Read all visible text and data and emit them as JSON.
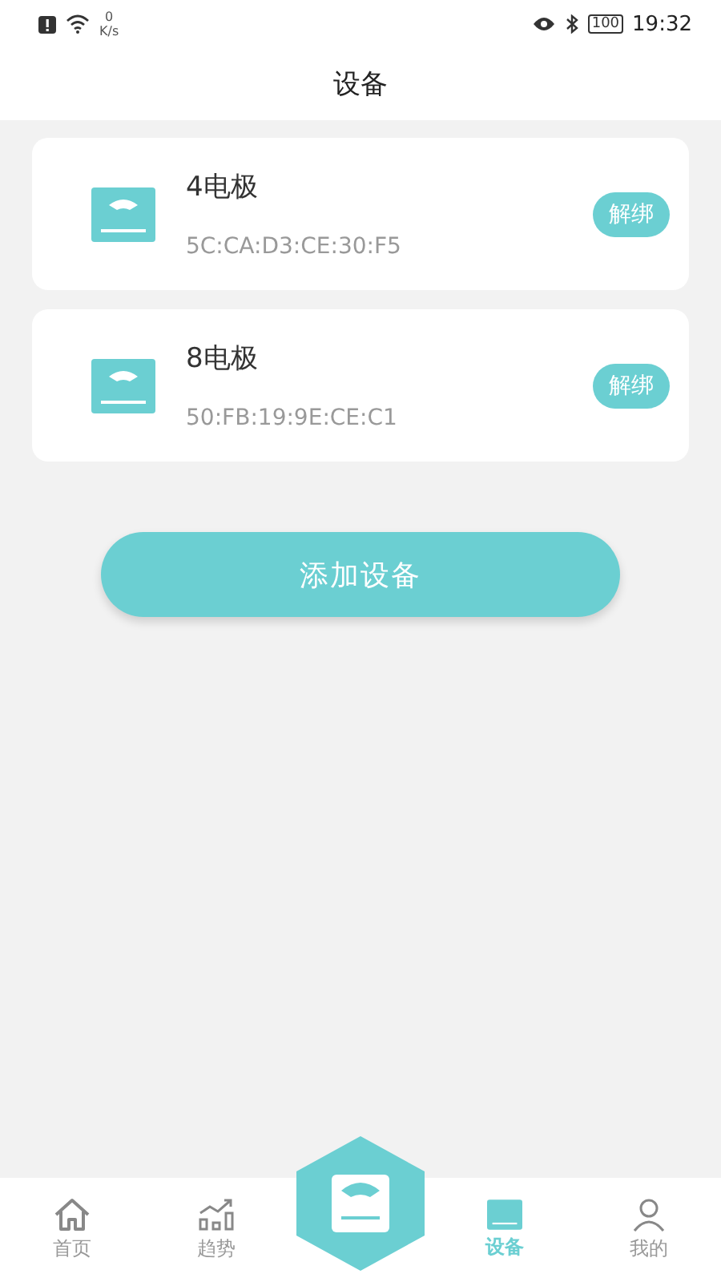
{
  "status_bar": {
    "speed_value": "0",
    "speed_unit": "K/s",
    "battery": "100",
    "time": "19:32"
  },
  "header": {
    "title": "设备"
  },
  "devices": [
    {
      "name": "4电极",
      "mac": "5C:CA:D3:CE:30:F5",
      "action": "解绑"
    },
    {
      "name": "8电极",
      "mac": "50:FB:19:9E:CE:C1",
      "action": "解绑"
    }
  ],
  "add_button": "添加设备",
  "nav": [
    {
      "kind": "home",
      "label": "首页",
      "selected": false
    },
    {
      "kind": "trend",
      "label": "趋势",
      "selected": false
    },
    {
      "kind": "center"
    },
    {
      "kind": "device",
      "label": "设备",
      "selected": true
    },
    {
      "kind": "mine",
      "label": "我的",
      "selected": false
    }
  ]
}
